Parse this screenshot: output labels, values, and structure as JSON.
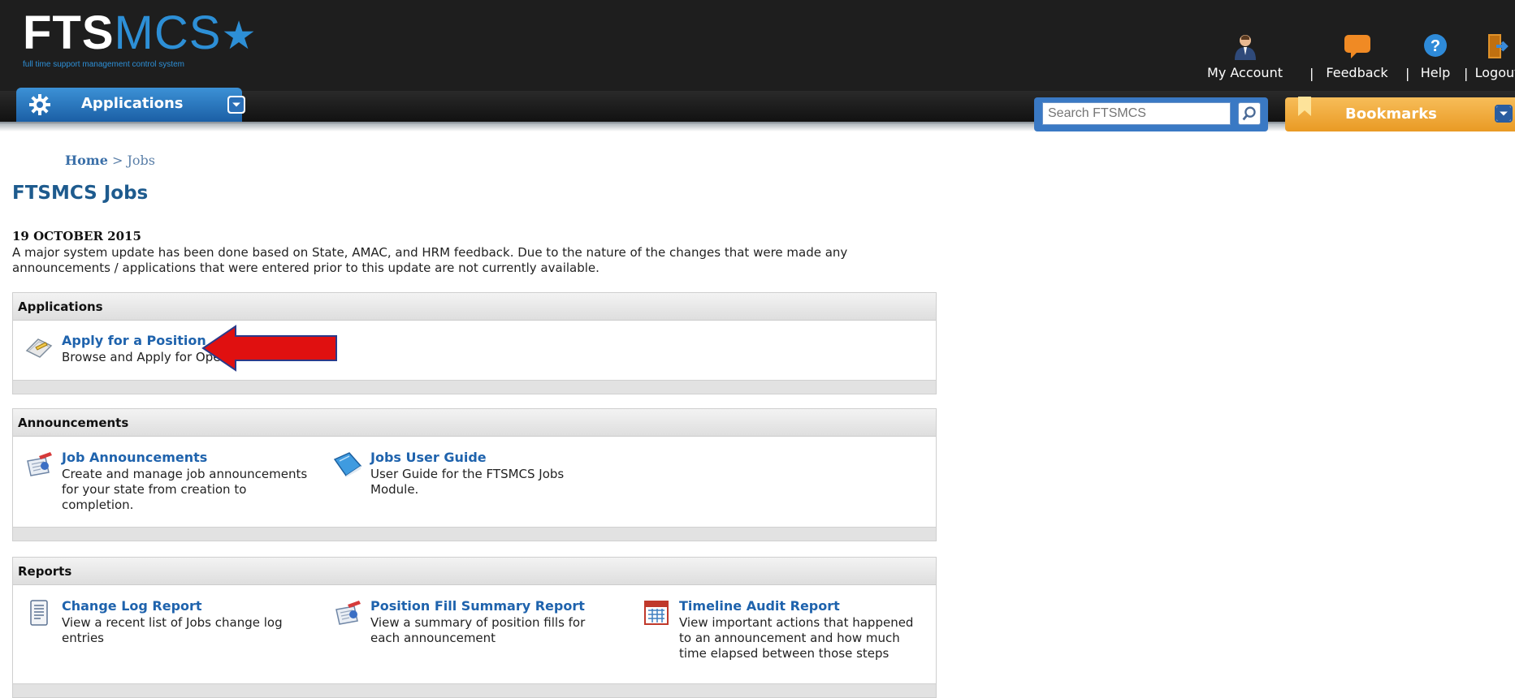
{
  "header": {
    "logo_fts": "FTS",
    "logo_mcs": "MCS",
    "logo_star": "★",
    "logo_tagline": "full time support management control system",
    "apps_menu_label": "Applications",
    "user_links": {
      "my_account": "My Account",
      "feedback": "Feedback",
      "help": "Help",
      "logout": "Logout",
      "separator": "|"
    },
    "search": {
      "placeholder": "Search FTSMCS"
    },
    "bookmarks_label": "Bookmarks"
  },
  "breadcrumb": {
    "home": "Home",
    "separator": ">",
    "current": "Jobs"
  },
  "page_title": "FTSMCS Jobs",
  "notice": {
    "date": "19 OCTOBER 2015",
    "text": "A major system update has been done based on State, AMAC, and HRM feedback. Due to the nature of the changes that were made any announcements / applications that were entered prior to this update are not currently available."
  },
  "sections": {
    "applications": {
      "title": "Applications",
      "items": [
        {
          "title": "Apply for a Position",
          "desc": "Browse and Apply for Open Positions",
          "icon": "apply-position-icon"
        }
      ]
    },
    "announcements": {
      "title": "Announcements",
      "items": [
        {
          "title": "Job Announcements",
          "desc": "Create and manage job announcements for your state from creation to completion.",
          "icon": "job-announcements-icon"
        },
        {
          "title": "Jobs User Guide",
          "desc": "User Guide for the FTSMCS Jobs Module.",
          "icon": "user-guide-book-icon"
        }
      ]
    },
    "reports": {
      "title": "Reports",
      "items": [
        {
          "title": "Change Log Report",
          "desc": "View a recent list of Jobs change log entries",
          "icon": "change-log-document-icon"
        },
        {
          "title": "Position Fill Summary Report",
          "desc": "View a summary of position fills for each announcement",
          "icon": "position-fill-report-icon"
        },
        {
          "title": "Timeline Audit Report",
          "desc": "View important actions that happened to an announcement and how much time elapsed between those steps",
          "icon": "timeline-calendar-icon"
        }
      ]
    }
  },
  "colors": {
    "header_bg": "#1e1e1e",
    "brand_blue": "#2d8fd6",
    "link_blue": "#1f63ad",
    "bookmarks_orange": "#f0a030",
    "annotation_arrow_red": "#e01010"
  }
}
